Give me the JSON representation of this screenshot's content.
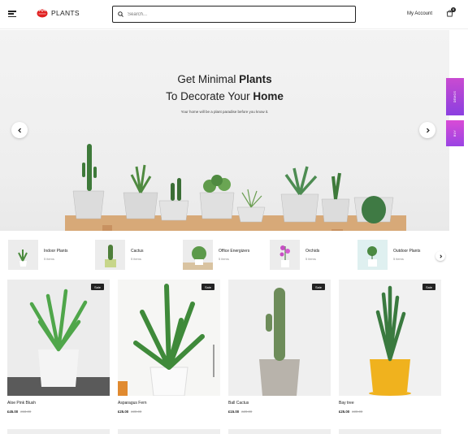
{
  "header": {
    "logo_text": "PLANTS",
    "search_placeholder": "Search...",
    "account_label": "My Account",
    "cart_count": "0"
  },
  "hero": {
    "title_line1_regular": "Get Minimal ",
    "title_line1_bold": "Plants",
    "title_line2_regular": "To Decorate Your ",
    "title_line2_bold": "Home",
    "subtitle": "Your home will be a plant paradise before you know it."
  },
  "side_tabs": {
    "demos": "DEMOS",
    "buy": "BUY"
  },
  "categories": [
    {
      "name": "Indoor Plants",
      "count": "5 items"
    },
    {
      "name": "Cactus",
      "count": "5 items"
    },
    {
      "name": "Office Energizers",
      "count": "5 items"
    },
    {
      "name": "Orchids",
      "count": "5 items"
    },
    {
      "name": "Outdoor Plants",
      "count": "5 items"
    }
  ],
  "products": [
    {
      "name": "Aloe Pink Blush",
      "price": "£45.00",
      "old_price": "£58.00",
      "badge": "Sale"
    },
    {
      "name": "Asparagus Fern",
      "price": "£25.00",
      "old_price": "£30.00",
      "badge": "Sale"
    },
    {
      "name": "Ball Cactus",
      "price": "£15.00",
      "old_price": "£20.00",
      "badge": "Sale"
    },
    {
      "name": "Bay tree",
      "price": "£25.00",
      "old_price": "£30.00",
      "badge": "Sale"
    }
  ],
  "colors": {
    "accent": "#222222",
    "shelf": "#d7a978",
    "side_tab": "#a845e0"
  }
}
